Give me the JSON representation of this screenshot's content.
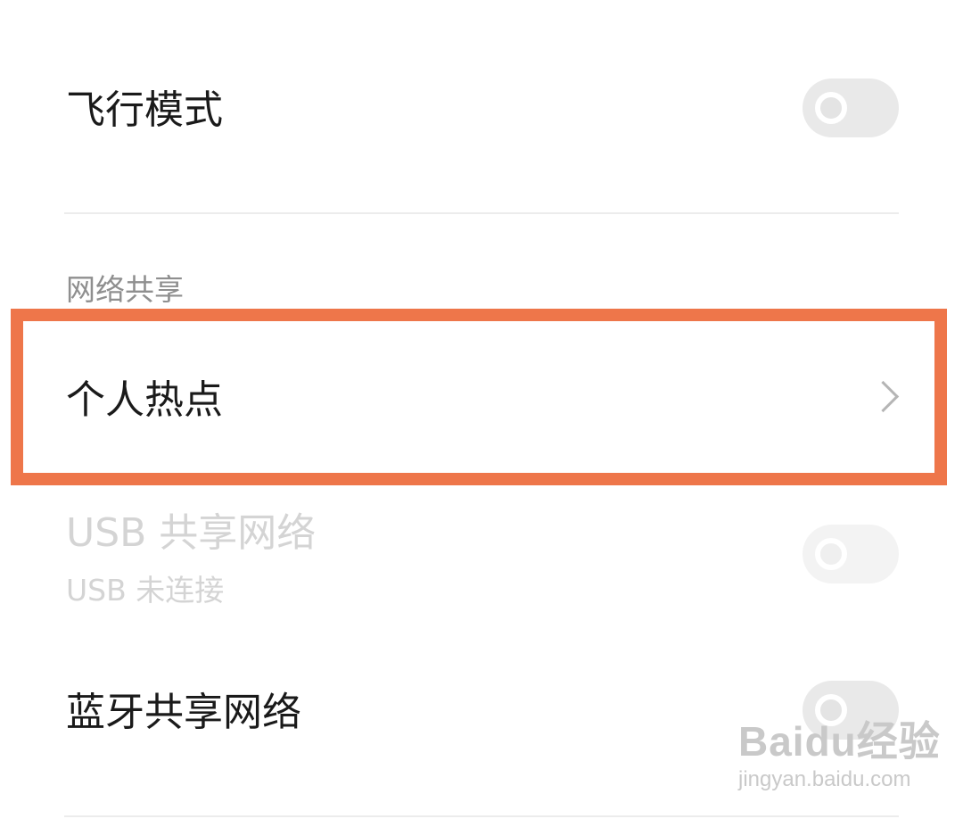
{
  "settings": {
    "airplane_mode": {
      "label": "飞行模式",
      "enabled": false
    },
    "section_header": "网络共享",
    "hotspot": {
      "label": "个人热点"
    },
    "usb_tethering": {
      "label": "USB 共享网络",
      "subtitle": "USB 未连接",
      "enabled": false,
      "disabled": true
    },
    "bluetooth_tethering": {
      "label": "蓝牙共享网络",
      "enabled": false
    }
  },
  "highlight_color": "#ee764a",
  "watermark": {
    "brand": "Baidu经验",
    "url": "jingyan.baidu.com"
  }
}
